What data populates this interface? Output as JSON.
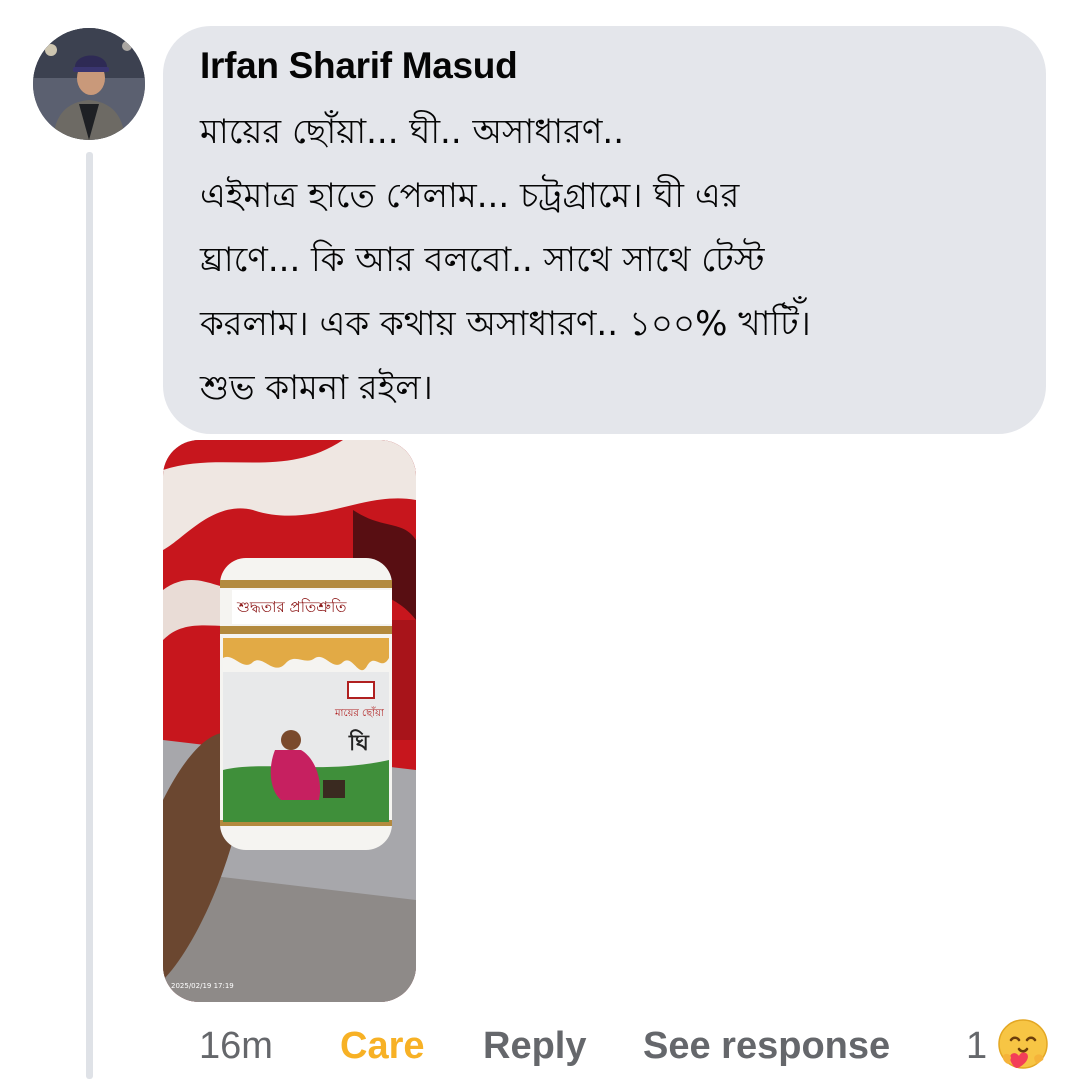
{
  "comment": {
    "author": "Irfan Sharif Masud",
    "lines": [
      "মায়ের ছোঁয়া... ঘী.. অসাধারণ..",
      "এইমাত্র হাতে পেলাম... চট্রগ্রামে। ঘী এর",
      "ঘ্রাণে...  কি আর বলবো.. সাথে সাথে টেস্ট",
      "করলাম। এক কথায় অসাধারণ..  ১০০% খাটিঁ।",
      "শুভ কামনা রইল।"
    ]
  },
  "photo": {
    "label_text": "শুদ্ধতার প্রতিশ্রুতি",
    "brand_text": "মায়ের ছোঁয়া",
    "product_text": "ঘি",
    "timestamp_text": "2025/02/19 17:19"
  },
  "actions": {
    "time": "16m",
    "care": "Care",
    "reply": "Reply",
    "see_response": "See response",
    "reaction_count": "1"
  },
  "icons": {
    "reaction": "care-emoji-icon"
  },
  "colors": {
    "bubble_bg": "#e4e6eb",
    "care_accent": "#f7b125",
    "muted_text": "#65676b",
    "thread_line": "#dfe2e7"
  }
}
